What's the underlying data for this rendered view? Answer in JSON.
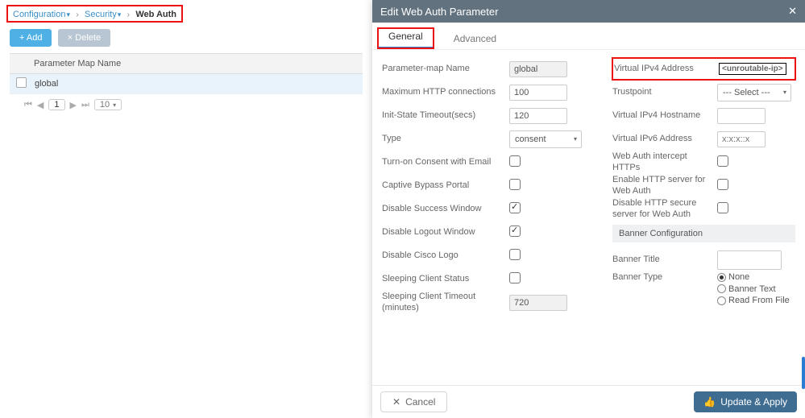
{
  "breadcrumb": {
    "a": "Configuration",
    "b": "Security",
    "c": "Web Auth"
  },
  "toolbar": {
    "add": "+  Add",
    "del": "×  Delete"
  },
  "table": {
    "col1": "Parameter Map Name",
    "rows": [
      {
        "name": "global"
      }
    ]
  },
  "pager": {
    "cur": "1",
    "size": "10"
  },
  "modal": {
    "title": "Edit Web Auth Parameter",
    "tabs": {
      "general": "General",
      "advanced": "Advanced"
    },
    "left": {
      "param_map_name": {
        "label": "Parameter-map Name",
        "value": "global"
      },
      "max_http": {
        "label": "Maximum HTTP connections",
        "value": "100"
      },
      "init_timeout": {
        "label": "Init-State Timeout(secs)",
        "value": "120"
      },
      "type": {
        "label": "Type",
        "value": "consent"
      },
      "turn_on_consent": {
        "label": "Turn-on Consent with Email"
      },
      "captive_bypass": {
        "label": "Captive Bypass Portal"
      },
      "disable_success": {
        "label": "Disable Success Window"
      },
      "disable_logout": {
        "label": "Disable Logout Window"
      },
      "disable_cisco": {
        "label": "Disable Cisco Logo"
      },
      "sleep_status": {
        "label": "Sleeping Client Status"
      },
      "sleep_timeout": {
        "label": "Sleeping Client Timeout (minutes)",
        "value": "720"
      }
    },
    "right": {
      "vipv4": {
        "label": "Virtual IPv4 Address",
        "value": "<unroutable-ip>"
      },
      "trustpoint": {
        "label": "Trustpoint",
        "value": "--- Select ---"
      },
      "vhost": {
        "label": "Virtual IPv4 Hostname",
        "value": ""
      },
      "vipv6": {
        "label": "Virtual IPv6 Address",
        "placeholder": "x:x:x::x"
      },
      "wauth_https": {
        "label": "Web Auth intercept HTTPs"
      },
      "http_enable": {
        "label": "Enable HTTP server for Web Auth"
      },
      "http_disable": {
        "label": "Disable HTTP secure server for Web Auth"
      },
      "banner_hdr": "Banner Configuration",
      "banner_title": {
        "label": "Banner Title",
        "value": ""
      },
      "banner_type": {
        "label": "Banner Type",
        "opts": {
          "none": "None",
          "text": "Banner Text",
          "file": "Read From File"
        }
      }
    },
    "footer": {
      "cancel": "Cancel",
      "apply": "Update & Apply"
    }
  }
}
